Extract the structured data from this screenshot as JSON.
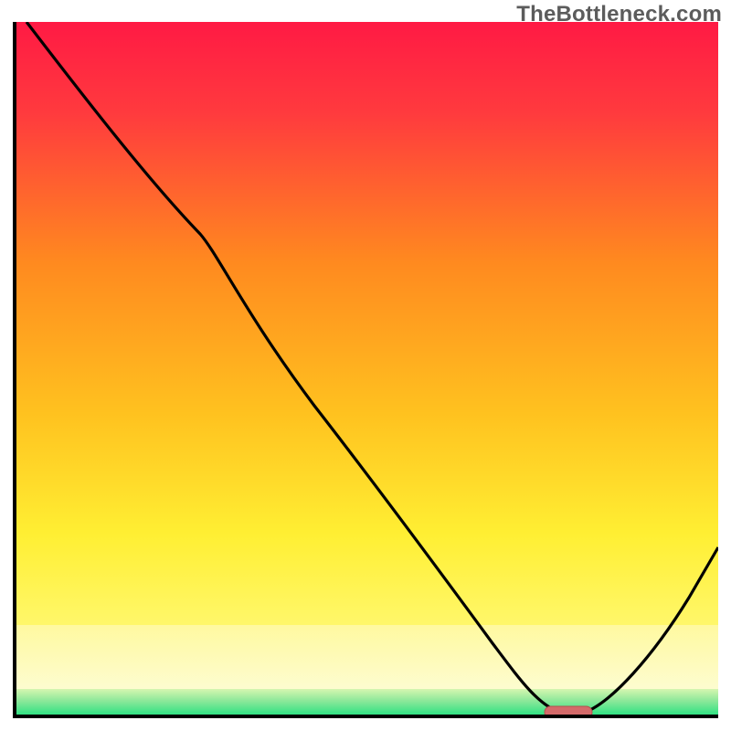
{
  "watermark": "TheBottleneck.com",
  "colors": {
    "red": "#ff1a44",
    "orange": "#ff8a1f",
    "yellow": "#ffef33",
    "pale_yellow": "#fffbb2",
    "green_light": "#a7f59a",
    "green": "#19e07d",
    "axis": "#000000",
    "curve": "#000000",
    "marker_fill": "#d46a6a",
    "marker_stroke": "#b54e4e"
  },
  "chart_data": {
    "type": "line",
    "title": "",
    "xlabel": "",
    "ylabel": "",
    "xlim": [
      0,
      100
    ],
    "ylim": [
      0,
      100
    ],
    "x": [
      2,
      10,
      18,
      24,
      28,
      35,
      45,
      55,
      62,
      68,
      72,
      76,
      80,
      86,
      92,
      100
    ],
    "values": [
      100,
      88,
      76,
      68,
      60,
      50,
      38,
      25,
      14,
      6,
      2,
      0,
      0,
      4,
      12,
      25
    ],
    "marker": {
      "x_start": 74,
      "x_end": 82,
      "y": 0
    },
    "annotations": []
  }
}
